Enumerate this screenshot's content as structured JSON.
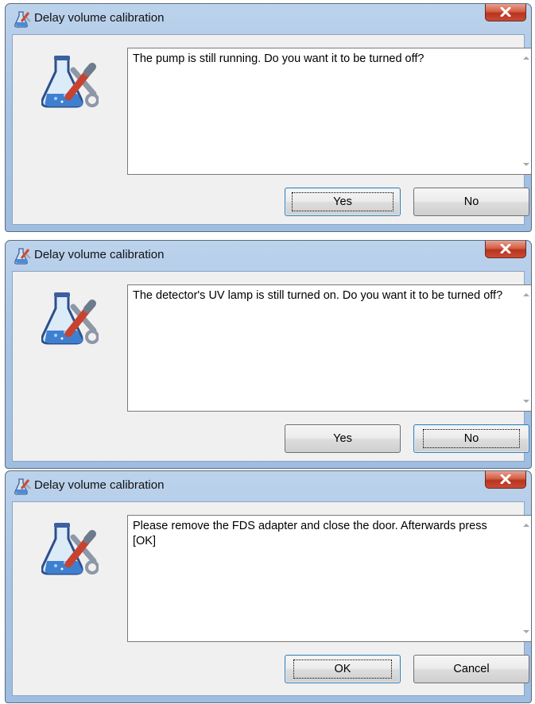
{
  "dialogs": [
    {
      "title": "Delay volume calibration",
      "message": "The pump is still running. Do you want it to be turned off?",
      "buttons": [
        {
          "label": "Yes",
          "focused": true
        },
        {
          "label": "No",
          "focused": false
        }
      ]
    },
    {
      "title": "Delay volume calibration",
      "message": "The detector's UV lamp is still turned on. Do you want it to be turned off?",
      "buttons": [
        {
          "label": "Yes",
          "focused": false
        },
        {
          "label": "No",
          "focused": true
        }
      ]
    },
    {
      "title": "Delay volume calibration",
      "message": "Please remove the FDS adapter and close the door. Afterwards press [OK]",
      "buttons": [
        {
          "label": "OK",
          "focused": true
        },
        {
          "label": "Cancel",
          "focused": false
        }
      ]
    }
  ],
  "icons": {
    "title": "flask-tools-icon",
    "close": "close-icon",
    "app": "flask-tools-icon"
  },
  "colors": {
    "close_button": "#c8432f",
    "frame": "#a9c4e4",
    "client": "#f0f0f0"
  }
}
